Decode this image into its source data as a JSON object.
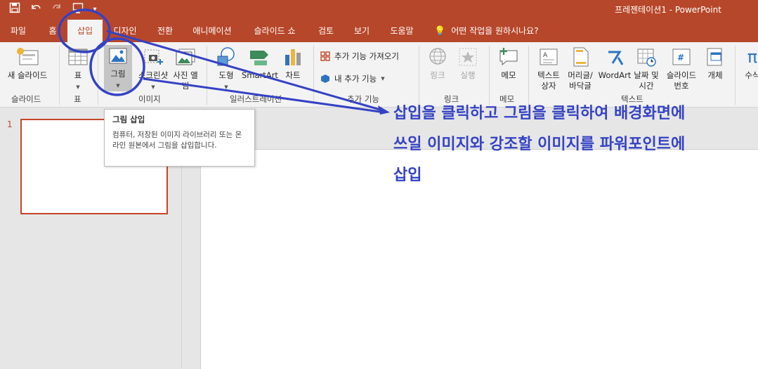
{
  "window": {
    "title": "프레젠테이션1 - PowerPoint",
    "qat": {
      "save": "save-icon",
      "undo": "undo-icon",
      "redo": "redo-icon",
      "present": "present-icon"
    }
  },
  "tabs": [
    "파일",
    "홈",
    "삽입",
    "디자인",
    "전환",
    "애니메이션",
    "슬라이드 쇼",
    "검토",
    "보기",
    "도움말"
  ],
  "active_tab": "삽입",
  "tell_me": "어떤 작업을 원하시나요?",
  "ribbon": {
    "slides": {
      "new_slide_label": "새 슬라이드",
      "group_label": "슬라이드"
    },
    "table": {
      "table_label": "표",
      "group_label": "표"
    },
    "images": {
      "picture_label": "그림",
      "screenshot_label": "스크린샷",
      "album_label": "사진 앨범",
      "group_label": "이미지"
    },
    "illustrations": {
      "shapes_label": "도형",
      "smartart_label": "SmartArt",
      "chart_label": "차트",
      "group_label": "일러스트레이션"
    },
    "addins": {
      "get_label": "추가 기능 가져오기",
      "my_label": "내 추가 기능",
      "group_label": "추가 기능"
    },
    "links": {
      "link_label": "링크",
      "action_label": "실행",
      "group_label": "링크"
    },
    "comments": {
      "comment_label": "메모",
      "group_label": "메모"
    },
    "text": {
      "textbox_label": "텍스트 상자",
      "header_label": "머리글/ 바닥글",
      "wordart_label": "WordArt",
      "datetime_label": "날짜 및 시간",
      "slidenum_label": "슬라이드 번호",
      "object_label": "개체",
      "group_label": "텍스트"
    },
    "symbols": {
      "equation_label": "수식"
    }
  },
  "tooltip": {
    "title": "그림 삽입",
    "body": "컴퓨터, 저장된 이미지 라이브러리 또는 온라인 원본에서 그림을 삽입합니다."
  },
  "slides": {
    "number": "1"
  },
  "annotation": {
    "lines": [
      "삽입을 클릭하고 그림을 클릭하여 배경화면에",
      "쓰일 이미지와 강조할 이미지를 파워포인트에",
      "삽입"
    ],
    "color": "#3542c4"
  },
  "colors": {
    "accent": "#b7472a",
    "ribbon_bg": "#f3f3f3",
    "annot": "#3542c4"
  }
}
